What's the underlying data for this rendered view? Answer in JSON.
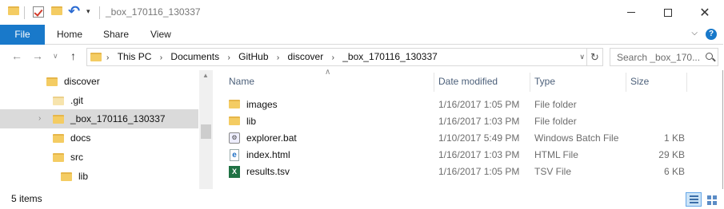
{
  "window": {
    "title": "_box_170116_130337"
  },
  "ribbon": {
    "tabs": [
      {
        "label": "File",
        "active": true
      },
      {
        "label": "Home"
      },
      {
        "label": "Share"
      },
      {
        "label": "View"
      }
    ],
    "accent": "#1979ca"
  },
  "address": {
    "crumbs": [
      "This PC",
      "Documents",
      "GitHub",
      "discover",
      "_box_170116_130337"
    ]
  },
  "search": {
    "placeholder": "Search _box_170..."
  },
  "nav_tree": [
    {
      "label": "discover",
      "level": 0
    },
    {
      "label": ".git",
      "level": 1
    },
    {
      "label": "_box_170116_130337",
      "level": 1,
      "selected": true
    },
    {
      "label": "docs",
      "level": 1
    },
    {
      "label": "src",
      "level": 1
    },
    {
      "label": "lib",
      "level": 2
    }
  ],
  "columns": {
    "name": "Name",
    "date": "Date modified",
    "type": "Type",
    "size": "Size"
  },
  "files": [
    {
      "name": "images",
      "date": "1/16/2017 1:05 PM",
      "type": "File folder",
      "size": "",
      "icon": "folder-icon"
    },
    {
      "name": "lib",
      "date": "1/16/2017 1:03 PM",
      "type": "File folder",
      "size": "",
      "icon": "folder-icon"
    },
    {
      "name": "explorer.bat",
      "date": "1/10/2017 5:49 PM",
      "type": "Windows Batch File",
      "size": "1 KB",
      "icon": "batch-file-icon"
    },
    {
      "name": "index.html",
      "date": "1/16/2017 1:03 PM",
      "type": "HTML File",
      "size": "29 KB",
      "icon": "html-file-icon"
    },
    {
      "name": "results.tsv",
      "date": "1/16/2017 1:05 PM",
      "type": "TSV File",
      "size": "6 KB",
      "icon": "excel-file-icon"
    }
  ],
  "status": {
    "items": "5 items"
  }
}
